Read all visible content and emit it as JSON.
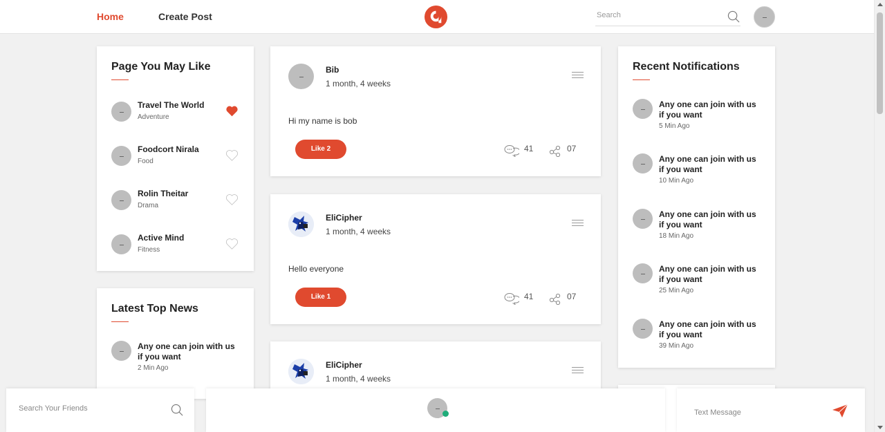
{
  "nav": {
    "home": "Home",
    "create_post": "Create Post",
    "search_placeholder": "Search"
  },
  "colors": {
    "accent": "#e04a2f",
    "online": "#1fad7a"
  },
  "avatar_placeholder": "–",
  "pages": {
    "title": "Page You May Like",
    "items": [
      {
        "name": "Travel The World",
        "category": "Adventure",
        "liked": true
      },
      {
        "name": "Foodcort Nirala",
        "category": "Food",
        "liked": false
      },
      {
        "name": "Rolin Theitar",
        "category": "Drama",
        "liked": false
      },
      {
        "name": "Active Mind",
        "category": "Fitness",
        "liked": false
      }
    ]
  },
  "news": {
    "title": "Latest Top News",
    "items": [
      {
        "text": "Any one can join with us if you want",
        "time": "2 Min Ago"
      }
    ]
  },
  "posts": [
    {
      "author": "Bib",
      "time": "1 month, 4 weeks",
      "text": "Hi my name is bob",
      "like_label": "Like 2",
      "comments": "41",
      "shares": "07",
      "avatar": "placeholder"
    },
    {
      "author": "EliCipher",
      "time": "1 month, 4 weeks",
      "text": "Hello everyone",
      "like_label": "Like 1",
      "comments": "41",
      "shares": "07",
      "avatar": "image"
    },
    {
      "author": "EliCipher",
      "time": "1 month, 4 weeks",
      "avatar": "image"
    }
  ],
  "notifications": {
    "title": "Recent Notifications",
    "items": [
      {
        "text": "Any one can join with us if you want",
        "time": "5 Min Ago"
      },
      {
        "text": "Any one can join with us if you want",
        "time": "10 Min Ago"
      },
      {
        "text": "Any one can join with us if you want",
        "time": "18 Min Ago"
      },
      {
        "text": "Any one can join with us if you want",
        "time": "25 Min Ago"
      },
      {
        "text": "Any one can join with us if you want",
        "time": "39 Min Ago"
      }
    ]
  },
  "chat": {
    "search_placeholder": "Search Your Friends",
    "message_placeholder": "Text Message"
  }
}
